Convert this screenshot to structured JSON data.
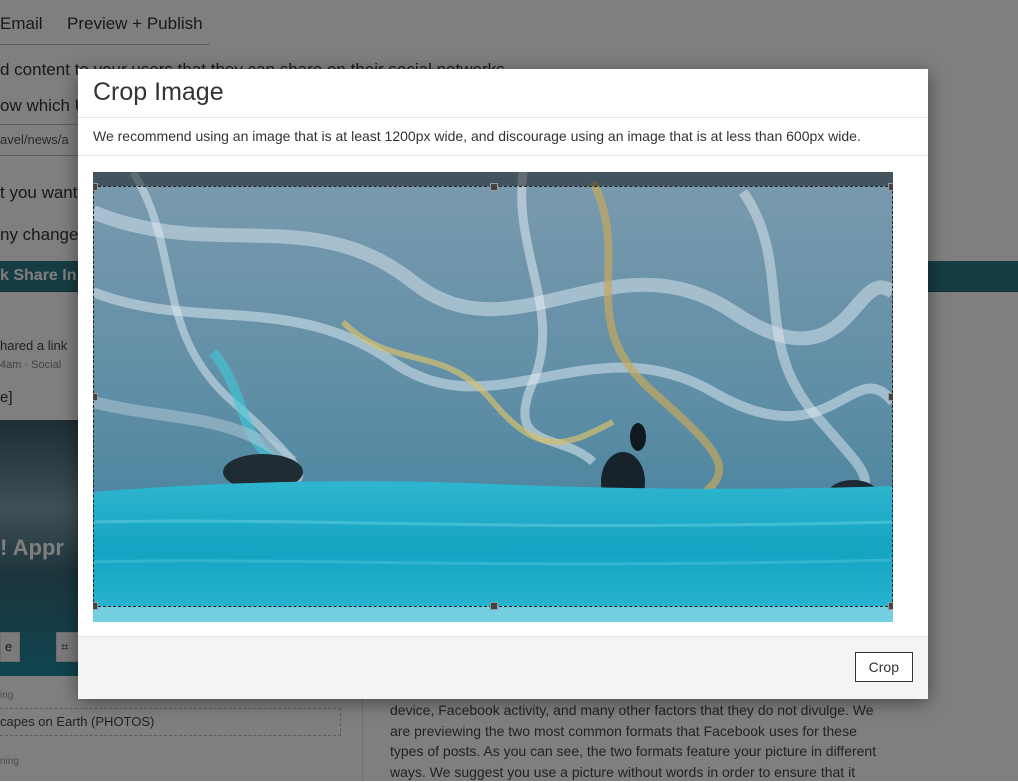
{
  "background": {
    "tabs": [
      "Email",
      "Preview + Publish"
    ],
    "lines": [
      "d content to your users that they can share on their social networks",
      "ow which U",
      "t you want",
      "ny change"
    ],
    "url_fragment": "avel/news/a",
    "band_text": "k Share In",
    "share_text": "hared a link",
    "meta_text": "4am · Social",
    "bracket_text": "e]",
    "approve_text": "! Appr",
    "button_left": "e",
    "button_right": "⌗",
    "label_1": "ing",
    "field_1": "capes on Earth (PHOTOS)",
    "label_2": "ning",
    "paragraph": "device, Facebook activity, and many other factors that they do not divulge. We are previewing the two most common formats that Facebook uses for these types of posts. As you can see, the two formats feature your picture in different ways. We suggest you use a picture without words in order to ensure that it"
  },
  "modal": {
    "title": "Crop Image",
    "description": "We recommend using an image that is at least 1200px wide, and discourage using an image that is at less than 600px wide.",
    "crop_button": "Crop"
  },
  "colors": {
    "band": "#2d7b86",
    "water": "#1aa6c4",
    "rock": "#5a7d93"
  }
}
